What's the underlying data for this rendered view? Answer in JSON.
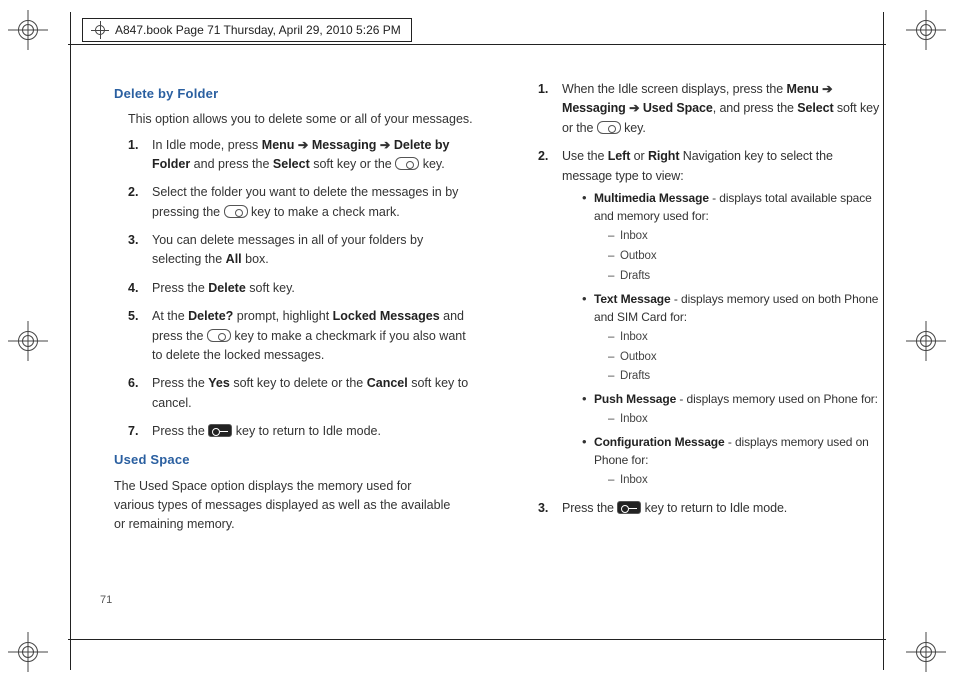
{
  "header": {
    "text": "A847.book  Page 71  Thursday, April 29, 2010  5:26 PM"
  },
  "page_number": "71",
  "left": {
    "h1": "Delete by Folder",
    "intro": "This option allows you to delete some or all of your messages.",
    "s1a": "In Idle mode, press ",
    "s1b": "Menu",
    "s1c": "Messaging",
    "s1d": "Delete by Folder",
    "s1e": " and press the ",
    "s1f": "Select",
    "s1g": " soft key or the ",
    "s1h": " key.",
    "s2a": "Select the folder you want to delete the messages in by pressing the ",
    "s2b": " key to make a check mark.",
    "s3a": "You can delete messages in all of your folders by selecting the ",
    "s3b": "All",
    "s3c": " box.",
    "s4a": "Press the ",
    "s4b": "Delete",
    "s4c": " soft key.",
    "s5a": "At the ",
    "s5b": "Delete?",
    "s5c": " prompt, highlight ",
    "s5d": "Locked Messages",
    "s5e": " and press the ",
    "s5f": " key to make a checkmark if you also want to delete the locked messages.",
    "s6a": "Press the ",
    "s6b": "Yes",
    "s6c": " soft key to delete or the ",
    "s6d": "Cancel",
    "s6e": " soft key to cancel.",
    "s7a": "Press the ",
    "s7b": " key to return to Idle mode.",
    "h2": "Used Space",
    "p2": "The Used Space option displays the memory used for various types of messages displayed as well as the available or remaining memory."
  },
  "right": {
    "s1a": "When the Idle screen displays, press the ",
    "s1b": "Menu",
    "s1c": "Messaging",
    "s1d": "Used Space",
    "s1e": ", and press the ",
    "s1f": "Select",
    "s1g": " soft key or the ",
    "s1h": " key.",
    "s2a": "Use the ",
    "s2b": "Left",
    "s2c": " or ",
    "s2d": "Right",
    "s2e": " Navigation key to select the message type to view:",
    "mm_a": "Multimedia Message",
    "mm_b": " - displays total available space and memory used for:",
    "tm_a": "Text Message",
    "tm_b": " - displays memory used on both Phone and SIM Card for:",
    "pm_a": "Push Message",
    "pm_b": " - displays memory used on Phone for:",
    "cm_a": "Configuration Message",
    "cm_b": " - displays memory used on Phone for:",
    "inbox": "Inbox",
    "outbox": "Outbox",
    "drafts": "Drafts",
    "s3a": "Press the ",
    "s3b": " key to return to Idle mode."
  },
  "arrow": " ➔ "
}
